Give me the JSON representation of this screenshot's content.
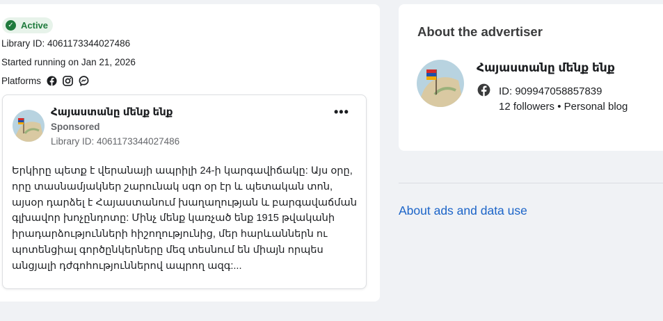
{
  "status": {
    "label": "Active",
    "color": "#1e7a3c"
  },
  "library_id_line": "Library ID: 4061173344027486",
  "started_line": "Started running on Jan 21, 2026",
  "platforms_label": "Platforms",
  "platform_icons": [
    "facebook-icon",
    "instagram-icon",
    "messenger-icon"
  ],
  "ad": {
    "page_name": "Հայաստանը մենք ենք",
    "sponsored": "Sponsored",
    "library_id": "Library ID: 4061173344027486",
    "more_label": "•••",
    "body": "Երկիրը պետք է վերանայի ապրիլի 24-ի կարգավիճակը: Այս օրը, որը տասնամյակներ շարունակ սգո օր էր և պետական տոն, այսօր դարձել է Հայաստանում խաղաղության և բարգավաճման գլխավոր խոչընդոտը: Մինչ մենք կառչած ենք 1915 թվականի իրադարձությունների հիշողությունից, մեր հարևաններն ու պոտենցիալ գործընկերները մեզ տեսնում են միայն որպես անցյալի դժգոհություններով ապրող ազգ:..."
  },
  "advertiser": {
    "section_title": "About the advertiser",
    "name": "Հայաստանը մենք ենք",
    "id_line": "ID: 909947058857839",
    "followers_line": "12 followers • Personal blog"
  },
  "about_ads_link": "About ads and data use",
  "colors": {
    "link": "#1b64c8",
    "badge_bg": "#e7f3ea",
    "page_bg": "#f0f2f5"
  }
}
